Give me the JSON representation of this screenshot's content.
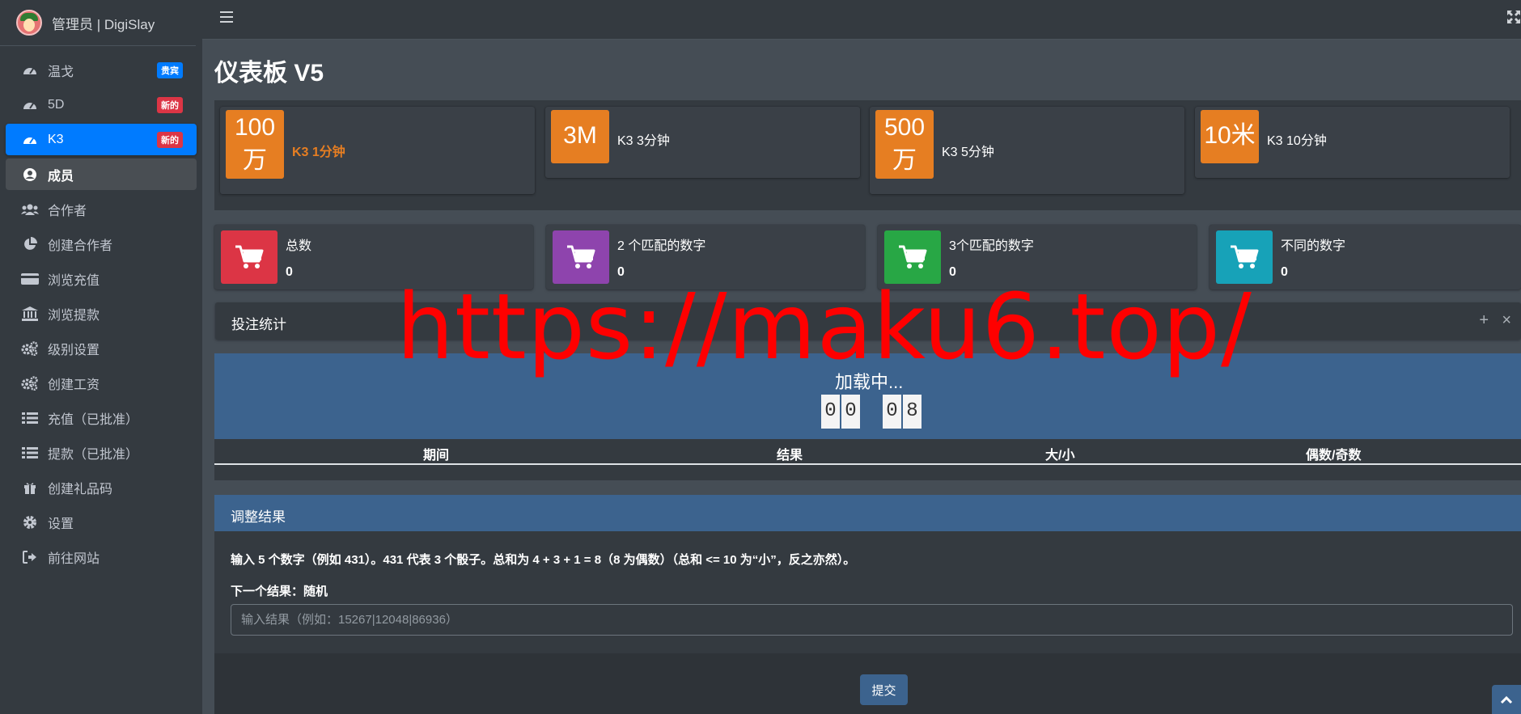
{
  "brand": {
    "title": "管理员 | DigiSlay"
  },
  "sidebar": {
    "items": [
      {
        "label": "温戈",
        "icon": "dashboard-icon",
        "badge": "贵宾",
        "badge_color": "#007bff"
      },
      {
        "label": "5D",
        "icon": "dashboard-icon",
        "badge": "新的",
        "badge_color": "#dc3545"
      },
      {
        "label": "K3",
        "icon": "dashboard-icon",
        "badge": "新的",
        "badge_color": "#dc3545",
        "active": true
      },
      {
        "label": "成员",
        "icon": "user-circle-icon",
        "highlight": true
      },
      {
        "label": "合作者",
        "icon": "users-icon"
      },
      {
        "label": "创建合作者",
        "icon": "pie-chart-icon"
      },
      {
        "label": "浏览充值",
        "icon": "credit-card-icon"
      },
      {
        "label": "浏览提款",
        "icon": "bank-icon"
      },
      {
        "label": "级别设置",
        "icon": "cogs-icon"
      },
      {
        "label": "创建工资",
        "icon": "cogs-icon"
      },
      {
        "label": "充值（已批准）",
        "icon": "list-icon"
      },
      {
        "label": "提款（已批准）",
        "icon": "list-icon"
      },
      {
        "label": "创建礼品码",
        "icon": "gift-icon"
      },
      {
        "label": "设置",
        "icon": "cog-icon"
      },
      {
        "label": "前往网站",
        "icon": "sign-out-icon"
      }
    ]
  },
  "page": {
    "title": "仪表板 V5"
  },
  "game_boxes": [
    {
      "value": "100万",
      "label": "K3 1分钟",
      "highlight": true
    },
    {
      "value": "3M",
      "label": "K3 3分钟"
    },
    {
      "value": "500万",
      "label": "K3 5分钟"
    },
    {
      "value": "10米",
      "label": "K3 10分钟"
    }
  ],
  "stats": [
    {
      "label": "总数",
      "value": "0",
      "color": "#dc3545",
      "icon": "cart-icon"
    },
    {
      "label": "2 个匹配的数字",
      "value": "0",
      "color": "#8e44ad",
      "icon": "cart-icon"
    },
    {
      "label": "3个匹配的数字",
      "value": "0",
      "color": "#28a745",
      "icon": "cart-icon"
    },
    {
      "label": "不同的数字",
      "value": "0",
      "color": "#17a2b8",
      "icon": "cart-icon"
    }
  ],
  "bet_stats": {
    "title": "投注统计",
    "loading": "加载中...",
    "countdown": [
      "0",
      "0",
      "0",
      "8"
    ],
    "columns": [
      "期间",
      "结果",
      "大/小",
      "偶数/奇数"
    ]
  },
  "adjust": {
    "title": "调整结果",
    "description": "输入 5 个数字（例如 431）。431 代表 3 个骰子。总和为 4 + 3 + 1 = 8（8 为偶数）（总和 <= 10 为“小”，反之亦然）。",
    "next_result": "下一个结果：随机",
    "placeholder": "输入结果（例如：15267|12048|86936）",
    "submit": "提交"
  },
  "watermark": "https://maku6.top/",
  "accent": "#007bff",
  "header_band": "#3c638e"
}
